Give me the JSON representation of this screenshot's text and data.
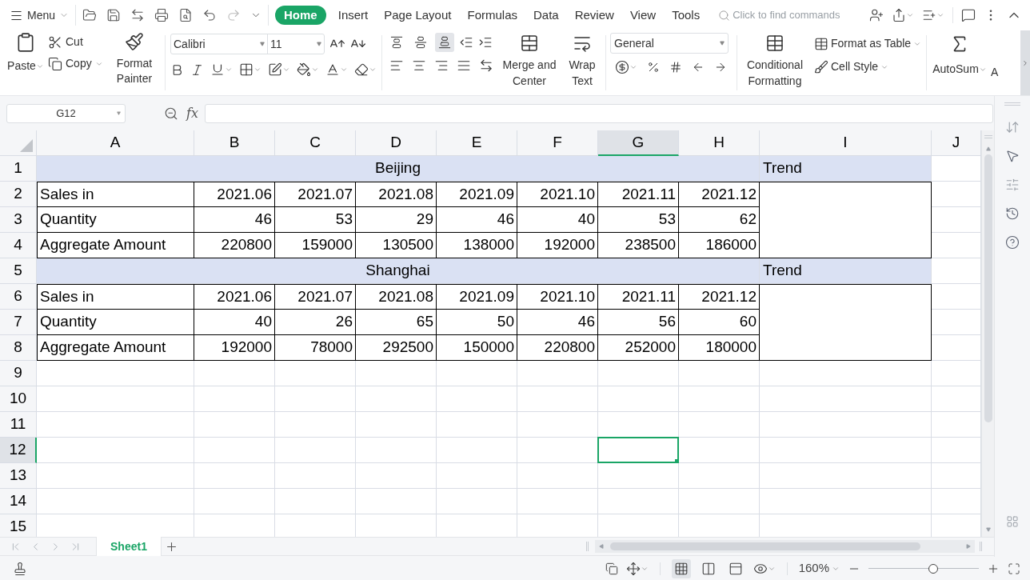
{
  "menubar": {
    "menu": "Menu",
    "tabs": [
      {
        "label": "Home",
        "selected": true
      },
      {
        "label": "Insert",
        "selected": false
      },
      {
        "label": "Page Layout",
        "selected": false
      },
      {
        "label": "Formulas",
        "selected": false
      },
      {
        "label": "Data",
        "selected": false
      },
      {
        "label": "Review",
        "selected": false
      },
      {
        "label": "View",
        "selected": false
      },
      {
        "label": "Tools",
        "selected": false
      }
    ],
    "search": {
      "placeholder": "Click to find commands"
    }
  },
  "ribbon": {
    "paste": "Paste",
    "cut": "Cut",
    "copy": "Copy",
    "format_painter": "Format Painter",
    "font": {
      "name": "Calibri",
      "size": "11"
    },
    "vertical_align": [
      {
        "kind": "top",
        "selected": false
      },
      {
        "kind": "middle",
        "selected": false
      },
      {
        "kind": "bottom",
        "selected": true
      }
    ],
    "merge": "Merge and Center",
    "wrap": "Wrap Text",
    "number_format": "General",
    "conditional": "Conditional Formatting",
    "format_table": "Format as Table",
    "cell_style": "Cell Style",
    "autosum": "AutoSum",
    "cut_off_label": "A"
  },
  "formula_bar": {
    "name_box": "G12",
    "function_label": "fx"
  },
  "sheet": {
    "columns": [
      {
        "label": "A",
        "selected": false
      },
      {
        "label": "B",
        "selected": false
      },
      {
        "label": "C",
        "selected": false
      },
      {
        "label": "D",
        "selected": false
      },
      {
        "label": "E",
        "selected": false
      },
      {
        "label": "F",
        "selected": false
      },
      {
        "label": "G",
        "selected": true
      },
      {
        "label": "H",
        "selected": false
      },
      {
        "label": "I",
        "selected": false
      },
      {
        "label": "J",
        "selected": false
      }
    ],
    "rows": [
      {
        "label": "1",
        "selected": false
      },
      {
        "label": "2",
        "selected": false
      },
      {
        "label": "3",
        "selected": false
      },
      {
        "label": "4",
        "selected": false
      },
      {
        "label": "5",
        "selected": false
      },
      {
        "label": "6",
        "selected": false
      },
      {
        "label": "7",
        "selected": false
      },
      {
        "label": "8",
        "selected": false
      },
      {
        "label": "9",
        "selected": false
      },
      {
        "label": "10",
        "selected": false
      },
      {
        "label": "11",
        "selected": false
      },
      {
        "label": "12",
        "selected": true
      },
      {
        "label": "13",
        "selected": false
      },
      {
        "label": "14",
        "selected": false
      },
      {
        "label": "15",
        "selected": false
      }
    ],
    "blocks": [
      {
        "title": "Beijing",
        "trend": "Trend",
        "lines": [
          {
            "label": "Sales in",
            "values": [
              "2021.06",
              "2021.07",
              "2021.08",
              "2021.09",
              "2021.10",
              "2021.11",
              "2021.12"
            ]
          },
          {
            "label": "Quantity",
            "values": [
              "46",
              "53",
              "29",
              "46",
              "40",
              "53",
              "62"
            ]
          },
          {
            "label": "Aggregate Amount",
            "values": [
              "220800",
              "159000",
              "130500",
              "138000",
              "192000",
              "238500",
              "186000"
            ]
          }
        ]
      },
      {
        "title": "Shanghai",
        "trend": "Trend",
        "lines": [
          {
            "label": "Sales in",
            "values": [
              "2021.06",
              "2021.07",
              "2021.08",
              "2021.09",
              "2021.10",
              "2021.11",
              "2021.12"
            ]
          },
          {
            "label": "Quantity",
            "values": [
              "40",
              "26",
              "65",
              "50",
              "46",
              "56",
              "60"
            ]
          },
          {
            "label": "Aggregate Amount",
            "values": [
              "192000",
              "78000",
              "292500",
              "150000",
              "220800",
              "252000",
              "180000"
            ]
          }
        ]
      }
    ]
  },
  "sheet_tabs": [
    {
      "label": "Sheet1",
      "selected": true
    }
  ],
  "status_bar": {
    "view_modes": [
      {
        "kind": "normal",
        "selected": true
      },
      {
        "kind": "page_break",
        "selected": false
      },
      {
        "kind": "page_layout",
        "selected": false
      }
    ],
    "zoom": "160%",
    "zoom_slider": {
      "level": 0.59
    }
  }
}
